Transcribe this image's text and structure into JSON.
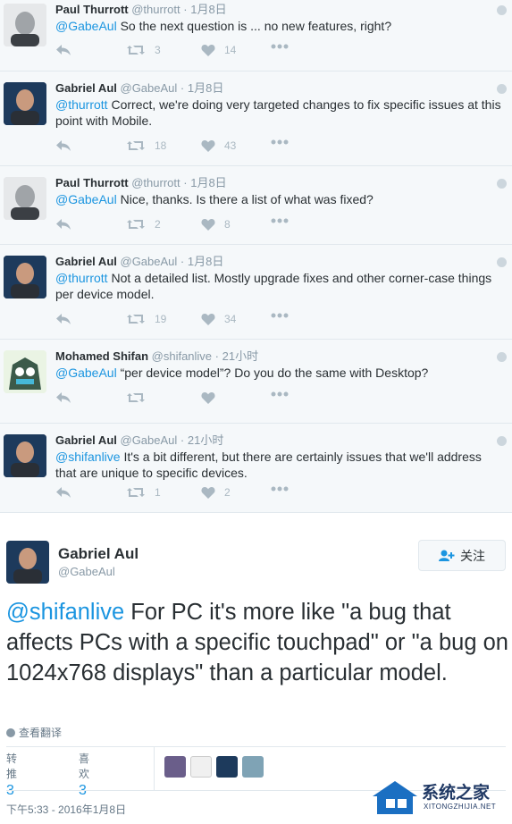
{
  "thread": [
    {
      "name": "Paul Thurrott",
      "handle": "@thurrott",
      "dot": "·",
      "time": "1月8日",
      "mention": "@GabeAul",
      "text": " So the next question is ... no new features, right?",
      "retweets": "3",
      "likes": "14",
      "avatar": "paul-thurrott"
    },
    {
      "name": "Gabriel Aul",
      "handle": "@GabeAul",
      "dot": "·",
      "time": "1月8日",
      "mention": "@thurrott",
      "text": " Correct, we're doing very targeted changes to fix specific issues at this point with Mobile.",
      "retweets": "18",
      "likes": "43",
      "avatar": "gabriel-aul"
    },
    {
      "name": "Paul Thurrott",
      "handle": "@thurrott",
      "dot": "·",
      "time": "1月8日",
      "mention": "@GabeAul",
      "text": " Nice, thanks. Is there a list of what was fixed?",
      "retweets": "2",
      "likes": "8",
      "avatar": "paul-thurrott"
    },
    {
      "name": "Gabriel Aul",
      "handle": "@GabeAul",
      "dot": "·",
      "time": "1月8日",
      "mention": "@thurrott",
      "text": " Not a detailed list. Mostly upgrade fixes and other corner-case things per device model.",
      "retweets": "19",
      "likes": "34",
      "avatar": "gabriel-aul"
    },
    {
      "name": "Mohamed Shifan",
      "handle": "@shifanlive",
      "dot": "·",
      "time": "21小时",
      "mention": "@GabeAul",
      "text": " “per device model”? Do you do the same with Desktop?",
      "retweets": "",
      "likes": "",
      "avatar": "mohamed-shifan"
    },
    {
      "name": "Gabriel Aul",
      "handle": "@GabeAul",
      "dot": "·",
      "time": "21小时",
      "mention": "@shifanlive",
      "text": " It's a bit different, but there are certainly issues that we'll address that are unique to specific devices.",
      "retweets": "1",
      "likes": "2",
      "avatar": "gabriel-aul"
    }
  ],
  "main": {
    "name": "Gabriel Aul",
    "handle": "@GabeAul",
    "follow_label": "关注",
    "mention": "@shifanlive",
    "text": " For PC it's more like \"a bug that affects PCs with a specific touchpad\" or \"a bug on 1024x768 displays\" than a particular model.",
    "translate": "查看翻译",
    "retweets_label": "转推",
    "retweets": "3",
    "likes_label": "喜欢",
    "likes": "3",
    "timestamp": "下午5:33 - 2016年1月8日"
  },
  "watermark": {
    "title": "系统之家",
    "subtitle": "XITONGZHIJIA.NET"
  },
  "colors": {
    "link": "#1b95e0",
    "muted": "#8899a6",
    "icon": "#aab8c2",
    "border": "#e1e8ed"
  },
  "icons": [
    "reply-icon",
    "retweet-icon",
    "heart-icon",
    "more-icon",
    "add-user-icon",
    "globe-icon",
    "chevron-down-icon"
  ]
}
